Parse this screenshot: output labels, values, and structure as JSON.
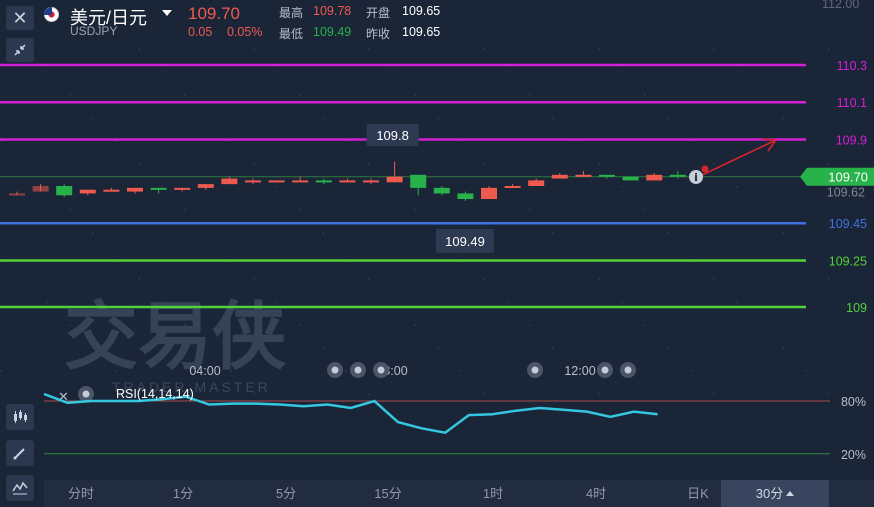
{
  "header": {
    "close_icon": "✕",
    "pair_name": "美元/日元",
    "pair_code": "USDJPY",
    "price": "109.70",
    "change": "0.05",
    "change_pct": "0.05%",
    "high_label": "最高",
    "high_value": "109.78",
    "low_label": "最低",
    "low_value": "109.49",
    "open_label": "开盘",
    "open_value": "109.65",
    "prev_close_label": "昨收",
    "prev_close_value": "109.65"
  },
  "colors": {
    "up": "#ef5a4f",
    "down": "#27b24a",
    "background": "#1b2538",
    "magenta": "#d41fd6",
    "blue": "#3f72df",
    "green": "#52d23a",
    "rsi": "#33c8e0"
  },
  "chart_data": {
    "type": "candlestick",
    "y_axis_top_label": "112.00",
    "current_price": "109.70",
    "reference_price": "109.62",
    "high_marker": "109.8",
    "low_marker": "109.49",
    "levels": [
      {
        "value": 110.3,
        "label": "110.3",
        "color": "#d41fd6"
      },
      {
        "value": 110.1,
        "label": "110.1",
        "color": "#d41fd6"
      },
      {
        "value": 109.9,
        "label": "109.9",
        "color": "#d41fd6"
      },
      {
        "value": 109.45,
        "label": "109.45",
        "color": "#3f72df"
      },
      {
        "value": 109.25,
        "label": "109.25",
        "color": "#52d23a"
      },
      {
        "value": 109.0,
        "label": "109",
        "color": "#52d23a"
      }
    ],
    "candles": [
      {
        "o": 109.61,
        "c": 109.61,
        "h": 109.62,
        "l": 109.6
      },
      {
        "o": 109.62,
        "c": 109.65,
        "h": 109.66,
        "l": 109.62
      },
      {
        "o": 109.65,
        "c": 109.6,
        "h": 109.66,
        "l": 109.59
      },
      {
        "o": 109.61,
        "c": 109.63,
        "h": 109.63,
        "l": 109.6
      },
      {
        "o": 109.63,
        "c": 109.63,
        "h": 109.64,
        "l": 109.62
      },
      {
        "o": 109.62,
        "c": 109.64,
        "h": 109.64,
        "l": 109.61
      },
      {
        "o": 109.64,
        "c": 109.63,
        "h": 109.64,
        "l": 109.61
      },
      {
        "o": 109.63,
        "c": 109.64,
        "h": 109.64,
        "l": 109.62
      },
      {
        "o": 109.64,
        "c": 109.66,
        "h": 109.66,
        "l": 109.63
      },
      {
        "o": 109.66,
        "c": 109.69,
        "h": 109.7,
        "l": 109.66
      },
      {
        "o": 109.68,
        "c": 109.68,
        "h": 109.69,
        "l": 109.66
      },
      {
        "o": 109.67,
        "c": 109.68,
        "h": 109.68,
        "l": 109.67
      },
      {
        "o": 109.68,
        "c": 109.68,
        "h": 109.7,
        "l": 109.67
      },
      {
        "o": 109.68,
        "c": 109.67,
        "h": 109.69,
        "l": 109.66
      },
      {
        "o": 109.68,
        "c": 109.68,
        "h": 109.69,
        "l": 109.67
      },
      {
        "o": 109.67,
        "c": 109.68,
        "h": 109.69,
        "l": 109.66
      },
      {
        "o": 109.67,
        "c": 109.7,
        "h": 109.78,
        "l": 109.67
      },
      {
        "o": 109.71,
        "c": 109.64,
        "h": 109.71,
        "l": 109.6
      },
      {
        "o": 109.64,
        "c": 109.61,
        "h": 109.65,
        "l": 109.6
      },
      {
        "o": 109.61,
        "c": 109.58,
        "h": 109.62,
        "l": 109.57
      },
      {
        "o": 109.58,
        "c": 109.64,
        "h": 109.65,
        "l": 109.58
      },
      {
        "o": 109.64,
        "c": 109.65,
        "h": 109.66,
        "l": 109.64
      },
      {
        "o": 109.65,
        "c": 109.68,
        "h": 109.69,
        "l": 109.65
      },
      {
        "o": 109.69,
        "c": 109.71,
        "h": 109.72,
        "l": 109.69
      },
      {
        "o": 109.71,
        "c": 109.71,
        "h": 109.73,
        "l": 109.7
      },
      {
        "o": 109.71,
        "c": 109.7,
        "h": 109.71,
        "l": 109.69
      },
      {
        "o": 109.7,
        "c": 109.68,
        "h": 109.7,
        "l": 109.68
      },
      {
        "o": 109.68,
        "c": 109.71,
        "h": 109.72,
        "l": 109.68
      },
      {
        "o": 109.71,
        "c": 109.7,
        "h": 109.73,
        "l": 109.69
      }
    ],
    "time_labels": [
      "04:00",
      "08:00",
      "12:00"
    ],
    "rsi": {
      "label": "RSI(14,14,14)",
      "upper_label": "80%",
      "lower_label": "20%",
      "values": [
        88,
        78,
        80,
        80,
        80,
        82,
        85,
        76,
        77,
        77,
        76,
        74,
        76,
        72,
        80,
        56,
        49,
        44,
        64,
        65,
        69,
        72,
        70,
        68,
        62,
        68,
        65
      ]
    }
  },
  "watermark": {
    "main": "交易侠",
    "sub": "TRADER MASTER"
  },
  "timeframes": [
    {
      "label": "分时",
      "active": false
    },
    {
      "label": "1分",
      "active": false
    },
    {
      "label": "5分",
      "active": false
    },
    {
      "label": "15分",
      "active": false
    },
    {
      "label": "1时",
      "active": false
    },
    {
      "label": "4时",
      "active": false
    },
    {
      "label": "日K",
      "active": false
    },
    {
      "label": "30分",
      "active": true
    }
  ]
}
